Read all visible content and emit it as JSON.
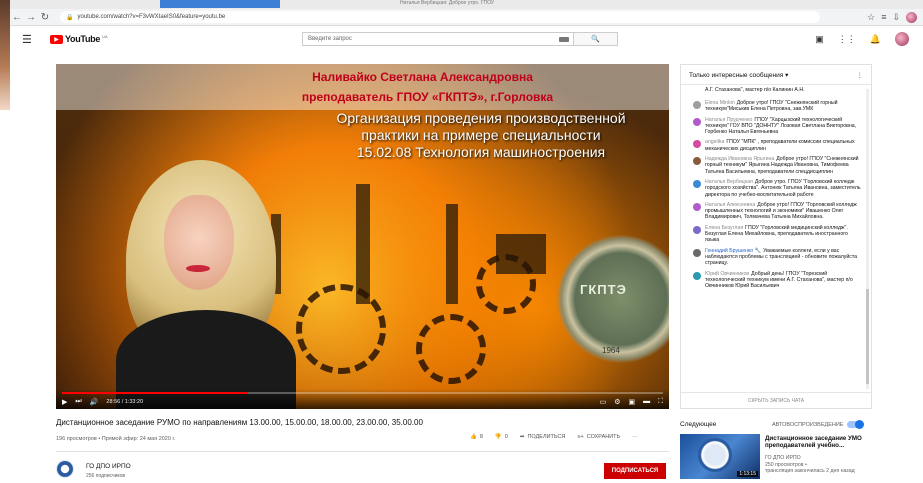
{
  "desktop": {
    "notice_text": "Наталья Вербицкая: Доброе утро. ГПОУ"
  },
  "browser": {
    "url": "youtube.com/watch?v=F3vWXtaeIS0&feature=youtu.be"
  },
  "header": {
    "logo_text": "YouTube",
    "logo_region": "UA",
    "search_placeholder": "Введите запрос"
  },
  "video": {
    "overlay_name": "Наливайко Светлана Александровна",
    "overlay_role": "преподаватель ГПОУ «ГКПТЭ», г.Горловка",
    "overlay_title": [
      "Организация проведения производственной",
      "практики на примере  специальности",
      "15.02.08 Технология машиностроения"
    ],
    "seal_text": "ГКПТЭ",
    "seal_year": "1964",
    "time_current": "28:56",
    "time_total": "1:33:20",
    "progress": 0.31
  },
  "info": {
    "title": "Дистанционное заседание РУМО по направлениям 13.00.00, 15.00.00, 18.00.00, 23.00.00, 35.00.00",
    "meta": "196 просмотров • Прямой эфир: 24 мая 2020 г.",
    "likes": "8",
    "dislikes": "0",
    "share_label": "ПОДЕЛИТЬСЯ",
    "save_label": "СОХРАНИТЬ"
  },
  "channel": {
    "name": "ГО ДПО ИРПО",
    "subscribers": "256 подписчиков",
    "subscribe_label": "ПОДПИСАТЬСЯ"
  },
  "chat": {
    "header": "Только интересные сообщения",
    "footer": "СКРЫТЬ ЗАПИСЬ ЧАТА",
    "messages": [
      {
        "author": "",
        "text": "А.Г. Стаханова\", мастер п/о Калинин А.Н.",
        "color": "#ffffff"
      },
      {
        "author": "Elena Minkin",
        "text": "Доброе утро! ГПОУ \"Снежнянский горный техникум\"Миськив Елена Петровна, зав.УМК",
        "color": "#9e9e9e"
      },
      {
        "author": "Наталья Прудченко",
        "text": "ГПОУ \"Харцызский технологический техникум\" ГОУ ВПО \"ДОННТУ\" Лозовая Светлана Викторовна, Горбенко Наталья Евгеньевна",
        "color": "#b05cc8"
      },
      {
        "author": "angelika",
        "text": "ГПОУ \"МПК\" , преподаватели комиссии специальных механических дисциплин",
        "color": "#d64aa0"
      },
      {
        "author": "Надежда Ивановна Ярыгина",
        "text": "Доброе утро! ГПОУ \"Снежнянский горный техникум\" Ярыгина Надежда Ивановна, Тимофеева Татьяна Васильевна, преподаватели спецдисциплин",
        "color": "#8a5a3a"
      },
      {
        "author": "Наталья Вербицкая",
        "text": "Доброе утро. ГПОУ \"Горловский колледж городского хозяйства\". Антонюк Татьяна Ивановна, заместитель директора по учебно-воспитательной работе",
        "color": "#3a8ad6"
      },
      {
        "author": "Наталья Алексеевна",
        "text": "Доброе утро! ГПОУ \"Горловский колледж промышленных технологий и экономики\" Ивашенко Олег Владимирович, Толмачева Татьяна Михайловна.",
        "color": "#b05cc8"
      },
      {
        "author": "Елена Безуглая",
        "text": "ГПОУ \"Горловский медицинский колледж\". Безуглая Елена Михайловна, преподаватель иностранного языка",
        "color": "#7d6ac8"
      },
      {
        "author": "Геннадий Брушенко 🔧",
        "text": "Уважаемые коллеги, если у вас наблюдаются проблемы с трансляцией - обновите пожалуйста страницу.",
        "color": "#6a6a6a",
        "blue": true
      },
      {
        "author": "Юрий Овчинников",
        "text": "Добрый день! ГПОУ \"Торезский технологический техникум имени А.Г. Стаханова\", мастер п/о Овчинников Юрий Васильевич",
        "color": "#2a9ab0"
      }
    ]
  },
  "upnext": {
    "label": "Следующее",
    "autoplay_label": "АВТОВОСПРОИЗВЕДЕНИЕ",
    "autoplay_on": true,
    "title": "Дистанционное заседание УМО преподавателей учебно...",
    "channel": "ГО ДПО ИРПО",
    "views": "250 просмотров •",
    "status": "трансляция закончилась 2 дня назад",
    "duration": "1:13:15"
  },
  "colors": {
    "accent_red": "#cc0000",
    "overlay_red": "#c0001a",
    "link_blue": "#1a73e8"
  }
}
